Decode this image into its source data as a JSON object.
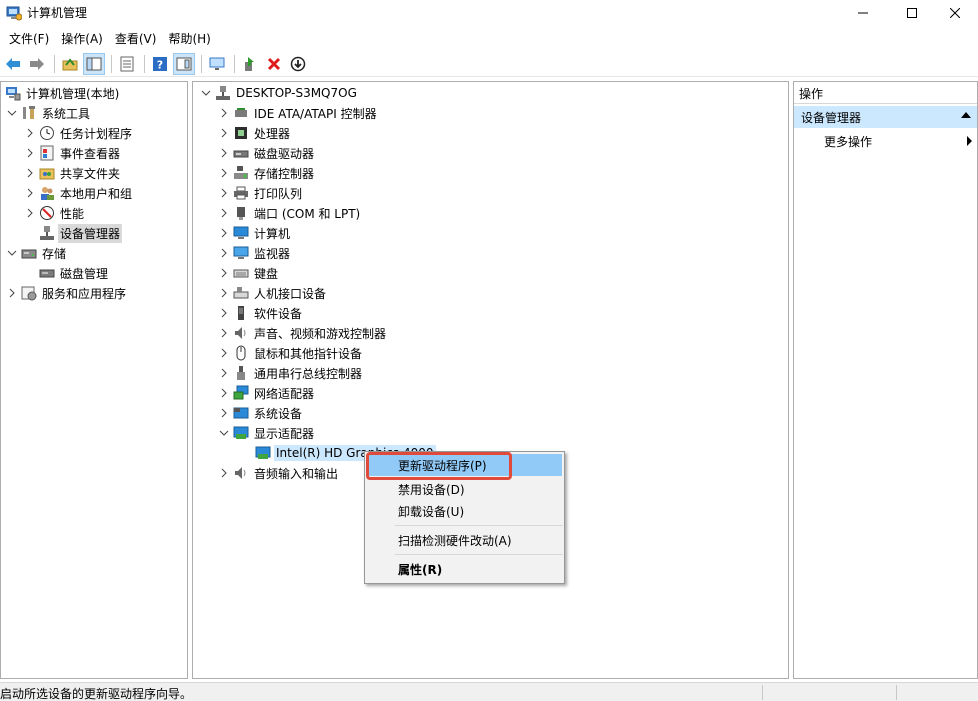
{
  "window": {
    "title": "计算机管理"
  },
  "menu": [
    "文件(F)",
    "操作(A)",
    "查看(V)",
    "帮助(H)"
  ],
  "toolbar": [
    "back-icon",
    "forward-icon",
    "up-folder-icon",
    "show-tree-icon",
    "export-list-icon",
    "help-icon",
    "properties-icon",
    "monitor-icon",
    "update-driver-icon",
    "uninstall-icon",
    "disable-icon"
  ],
  "left_tree": [
    {
      "label": "计算机管理(本地)",
      "expander": "",
      "icon": "computer-management-icon"
    },
    {
      "label": "系统工具",
      "expander": "v",
      "icon": "system-tools-icon"
    },
    {
      "label": "任务计划程序",
      "expander": ">",
      "icon": "task-scheduler-icon"
    },
    {
      "label": "事件查看器",
      "expander": ">",
      "icon": "event-viewer-icon"
    },
    {
      "label": "共享文件夹",
      "expander": ">",
      "icon": "shared-folders-icon"
    },
    {
      "label": "本地用户和组",
      "expander": ">",
      "icon": "local-users-icon"
    },
    {
      "label": "性能",
      "expander": ">",
      "icon": "performance-icon"
    },
    {
      "label": "设备管理器",
      "expander": "",
      "icon": "device-manager-icon"
    },
    {
      "label": "存储",
      "expander": "v",
      "icon": "storage-icon"
    },
    {
      "label": "磁盘管理",
      "expander": "",
      "icon": "disk-management-icon"
    },
    {
      "label": "服务和应用程序",
      "expander": ">",
      "icon": "services-apps-icon"
    }
  ],
  "device_tree": {
    "root": "DESKTOP-S3MQ7OG",
    "categories": [
      {
        "label": "IDE ATA/ATAPI 控制器",
        "icon": "ide-controller-icon"
      },
      {
        "label": "处理器",
        "icon": "processor-icon"
      },
      {
        "label": "磁盘驱动器",
        "icon": "disk-drive-icon"
      },
      {
        "label": "存储控制器",
        "icon": "storage-controller-icon"
      },
      {
        "label": "打印队列",
        "icon": "printer-icon"
      },
      {
        "label": "端口 (COM 和 LPT)",
        "icon": "port-icon"
      },
      {
        "label": "计算机",
        "icon": "computer-icon"
      },
      {
        "label": "监视器",
        "icon": "monitor-icon"
      },
      {
        "label": "键盘",
        "icon": "keyboard-icon"
      },
      {
        "label": "人机接口设备",
        "icon": "hid-icon"
      },
      {
        "label": "软件设备",
        "icon": "software-device-icon"
      },
      {
        "label": "声音、视频和游戏控制器",
        "icon": "sound-icon"
      },
      {
        "label": "鼠标和其他指针设备",
        "icon": "mouse-icon"
      },
      {
        "label": "通用串行总线控制器",
        "icon": "usb-icon"
      },
      {
        "label": "网络适配器",
        "icon": "network-adapter-icon"
      },
      {
        "label": "系统设备",
        "icon": "system-device-icon"
      },
      {
        "label": "显示适配器",
        "icon": "display-adapter-icon"
      }
    ],
    "display_child": "Intel(R) HD Graphics 4000",
    "after_display": {
      "label": "音频输入和输出",
      "icon": "audio-io-icon"
    }
  },
  "actions": {
    "header": "操作",
    "selected": "设备管理器",
    "more": "更多操作"
  },
  "context_menu": {
    "items": [
      "更新驱动程序(P)",
      "禁用设备(D)",
      "卸载设备(U)",
      "扫描检测硬件改动(A)",
      "属性(R)"
    ]
  },
  "status": {
    "text": "启动所选设备的更新驱动程序向导。"
  },
  "colors": {
    "selection": "#cce8ff",
    "menu_highlight": "#91c9f7",
    "annotation": "#e04a3a"
  }
}
